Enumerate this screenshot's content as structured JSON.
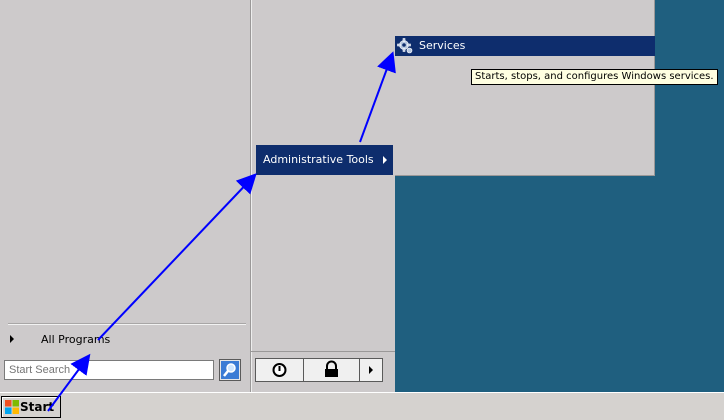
{
  "start_menu": {
    "all_programs_label": "All Programs",
    "search_placeholder": "Start Search",
    "admin_tools_label": "Administrative Tools"
  },
  "submenu": {
    "services_label": "Services",
    "tooltip": "Starts, stops, and configures Windows services."
  },
  "taskbar": {
    "start_label": "Start"
  },
  "colors": {
    "highlight": "#0e2d6d",
    "desktop": "#1f5f7f",
    "menu_bg": "#cdcacb",
    "annotation_arrow": "#0000ff"
  },
  "icons": {
    "services": "gear-icon",
    "search": "magnifier-icon",
    "power": "power-icon",
    "lock": "lock-icon",
    "start": "windows-logo-icon"
  }
}
